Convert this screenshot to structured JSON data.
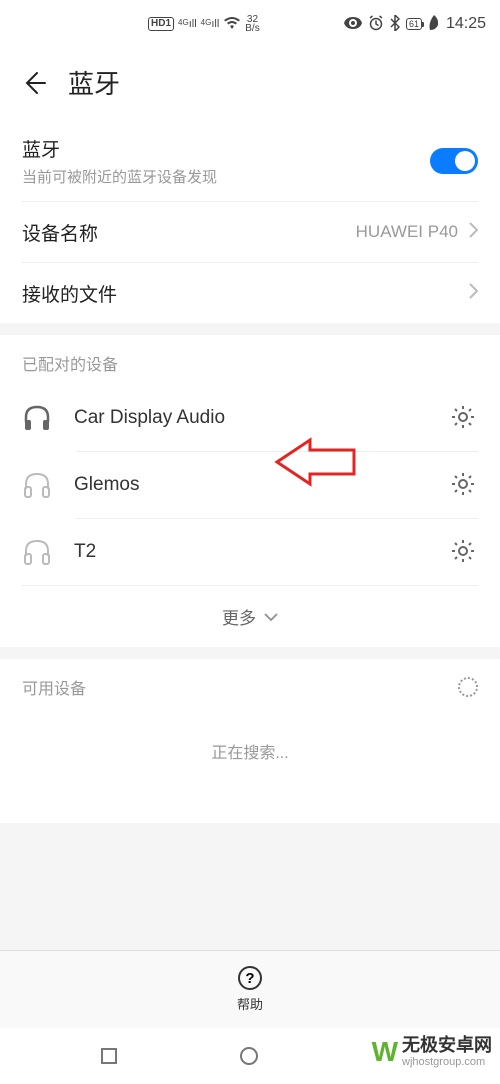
{
  "status": {
    "hd": "HD",
    "hd_suffix": "1",
    "net_speed": "32",
    "net_unit": "B/s",
    "battery": "61",
    "time": "14:25"
  },
  "header": {
    "title": "蓝牙"
  },
  "bluetooth": {
    "label": "蓝牙",
    "sub": "当前可被附近的蓝牙设备发现",
    "on": true
  },
  "device_name": {
    "label": "设备名称",
    "value": "HUAWEI P40"
  },
  "received_files": {
    "label": "接收的文件"
  },
  "paired": {
    "header": "已配对的设备",
    "items": [
      {
        "name": "Car Display Audio",
        "icon": "headphones-bold"
      },
      {
        "name": "Glemos",
        "icon": "headphones-light"
      },
      {
        "name": "T2",
        "icon": "headphones-light"
      }
    ],
    "more": "更多"
  },
  "available": {
    "header": "可用设备",
    "searching": "正在搜索..."
  },
  "help": "帮助",
  "watermark": {
    "brand": "W",
    "text": "无极安卓网",
    "url": "wjhostgroup.com"
  }
}
